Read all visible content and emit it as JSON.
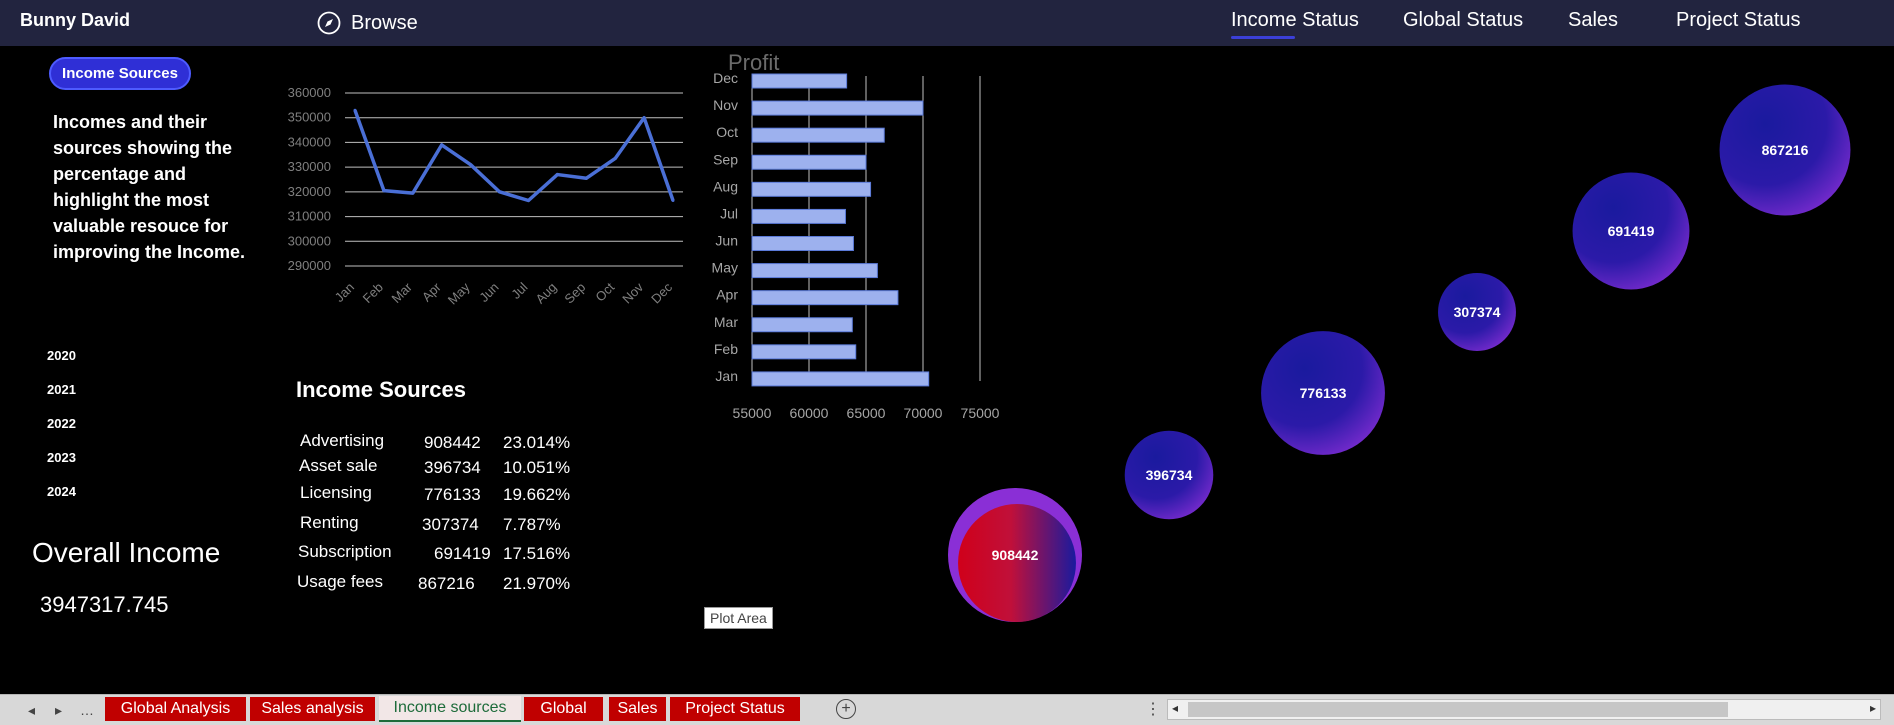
{
  "header": {
    "user_name": "Bunny David",
    "browse_label": "Browse",
    "nav": [
      "Income Status",
      "Global Status",
      "Sales",
      "Project Status"
    ]
  },
  "sidebar": {
    "button_label": "Income Sources",
    "description": "Incomes and their sources showing the percentage and highlight the most valuable resouce for improving the Income.",
    "years": [
      "2020",
      "2021",
      "2022",
      "2023",
      "2024"
    ],
    "overall_title": "Overall Income",
    "overall_value": "3947317.745"
  },
  "sources": {
    "title": "Income Sources",
    "rows": [
      {
        "name": "Advertising",
        "value": "908442",
        "pct": "23.014%"
      },
      {
        "name": "Asset sale",
        "value": "396734",
        "pct": "10.051%"
      },
      {
        "name": "Licensing",
        "value": "776133",
        "pct": "19.662%"
      },
      {
        "name": "Renting",
        "value": "307374",
        "pct": "7.787%"
      },
      {
        "name": "Subscription",
        "value": "691419",
        "pct": "17.516%"
      },
      {
        "name": "Usage fees",
        "value": "867216",
        "pct": "21.970%"
      }
    ]
  },
  "plot_tooltip": "Plot Area",
  "chart_data": [
    {
      "type": "line",
      "title": "",
      "categories": [
        "Jan",
        "Feb",
        "Mar",
        "Apr",
        "May",
        "Jun",
        "Jul",
        "Aug",
        "Sep",
        "Oct",
        "Nov",
        "Dec"
      ],
      "series": [
        {
          "values": [
            353000,
            320500,
            319500,
            339000,
            331000,
            320000,
            316500,
            327000,
            325500,
            333500,
            350000,
            316500
          ]
        }
      ],
      "ylim": [
        290000,
        360000
      ],
      "yticks": [
        290000,
        300000,
        310000,
        320000,
        330000,
        340000,
        350000,
        360000
      ],
      "color": "#4a6fd6",
      "grid": true
    },
    {
      "type": "bar",
      "orientation": "horizontal",
      "title": "Profit",
      "categories": [
        "Dec",
        "Nov",
        "Oct",
        "Sep",
        "Aug",
        "Jul",
        "Jun",
        "May",
        "Apr",
        "Mar",
        "Feb",
        "Jan"
      ],
      "values": [
        63300,
        70000,
        66600,
        65000,
        65400,
        63200,
        63900,
        66000,
        67800,
        63800,
        64100,
        70500
      ],
      "xlim": [
        55000,
        75000
      ],
      "xticks": [
        55000,
        60000,
        65000,
        70000,
        75000
      ],
      "color": "#9db1ee",
      "grid": true
    },
    {
      "type": "scatter",
      "subtype": "bubble",
      "points": [
        {
          "label": "908442",
          "value": 908442,
          "gradient": "red-purple"
        },
        {
          "label": "396734",
          "value": 396734,
          "gradient": "blue-purple"
        },
        {
          "label": "776133",
          "value": 776133,
          "gradient": "blue-purple"
        },
        {
          "label": "307374",
          "value": 307374,
          "gradient": "blue-purple"
        },
        {
          "label": "691419",
          "value": 691419,
          "gradient": "blue-purple"
        },
        {
          "label": "867216",
          "value": 867216,
          "gradient": "blue-purple"
        }
      ]
    }
  ],
  "sheets": {
    "nav": [
      "◂",
      "▸",
      "…"
    ],
    "tabs": [
      "Global Analysis",
      "Sales analysis",
      "Income sources",
      "Global",
      "Sales",
      "Project Status"
    ],
    "active_index": 2,
    "add_label": "+"
  }
}
